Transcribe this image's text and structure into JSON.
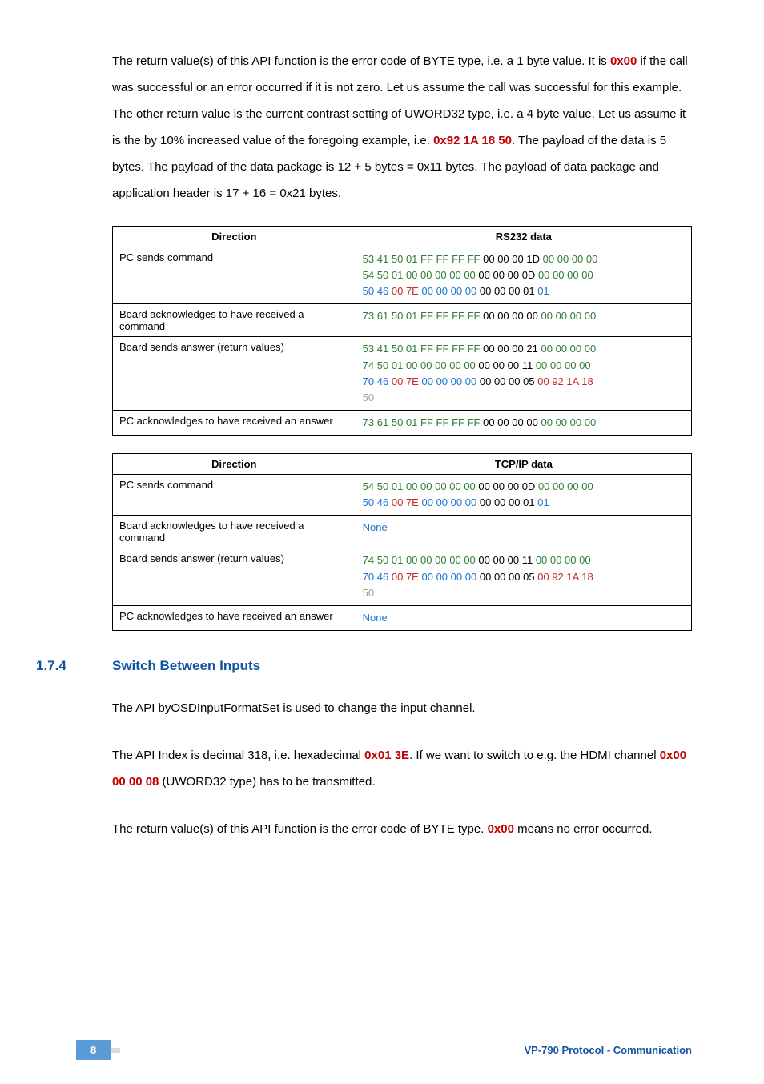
{
  "para1": {
    "t1": "The return value(s) of this API function is the error code of BYTE type, i.e. a 1 byte value. It is ",
    "h1": "0x00",
    "t2": " if the call was successful or an error occurred if it is not zero. Let us assume the call was successful for this example. The other return value is the current contrast setting of UWORD32 type, i.e. a 4 byte value. Let us assume it is the by 10% increased value of the foregoing example, i.e. ",
    "h2": "0x92 1A 18 50",
    "t3": ". The payload of the data is 5 bytes. The payload of the data package is 12 + 5 bytes = 0x11 bytes. The payload of data package and application header is 17 + 16 = 0x21 bytes."
  },
  "table1": {
    "h1": "Direction",
    "h2": "RS232 data",
    "rows": [
      {
        "dir": "PC sends command",
        "bytes": [
          [
            "g",
            "53"
          ],
          [
            "g",
            "41"
          ],
          [
            "g",
            "50"
          ],
          [
            "g",
            "01"
          ],
          [
            "g",
            "FF"
          ],
          [
            "g",
            "FF"
          ],
          [
            "g",
            "FF"
          ],
          [
            "g",
            "FF"
          ],
          [
            "k",
            "00"
          ],
          [
            "k",
            "00"
          ],
          [
            "k",
            "00"
          ],
          [
            "k",
            "1D"
          ],
          [
            "g",
            "00"
          ],
          [
            "g",
            "00"
          ],
          [
            "g",
            "00"
          ],
          [
            "g",
            "00"
          ],
          [
            "br"
          ],
          [
            "g",
            "54"
          ],
          [
            "g",
            "50"
          ],
          [
            "g",
            "01"
          ],
          [
            "g",
            "00"
          ],
          [
            "g",
            "00"
          ],
          [
            "g",
            "00"
          ],
          [
            "g",
            "00"
          ],
          [
            "g",
            "00"
          ],
          [
            "k",
            "00"
          ],
          [
            "k",
            "00"
          ],
          [
            "k",
            "00"
          ],
          [
            "k",
            "0D"
          ],
          [
            "g",
            "00"
          ],
          [
            "g",
            "00"
          ],
          [
            "g",
            "00"
          ],
          [
            "g",
            "00"
          ],
          [
            "br"
          ],
          [
            "b",
            "50"
          ],
          [
            "b",
            "46"
          ],
          [
            "r",
            "00"
          ],
          [
            "r",
            "7E"
          ],
          [
            "b",
            "00"
          ],
          [
            "b",
            "00"
          ],
          [
            "b",
            "00"
          ],
          [
            "b",
            "00"
          ],
          [
            "k",
            "00"
          ],
          [
            "k",
            "00"
          ],
          [
            "k",
            "00"
          ],
          [
            "k",
            "01"
          ],
          [
            "b",
            "01"
          ]
        ]
      },
      {
        "dir": "Board acknowledges to have received a command",
        "bytes": [
          [
            "g",
            "73"
          ],
          [
            "g",
            "61"
          ],
          [
            "g",
            "50"
          ],
          [
            "g",
            "01"
          ],
          [
            "g",
            "FF"
          ],
          [
            "g",
            "FF"
          ],
          [
            "g",
            "FF"
          ],
          [
            "g",
            "FF"
          ],
          [
            "k",
            "00"
          ],
          [
            "k",
            "00"
          ],
          [
            "k",
            "00"
          ],
          [
            "k",
            "00"
          ],
          [
            "g",
            "00"
          ],
          [
            "g",
            "00"
          ],
          [
            "g",
            "00"
          ],
          [
            "g",
            "00"
          ]
        ]
      },
      {
        "dir": "Board sends answer (return values)",
        "bytes": [
          [
            "g",
            "53"
          ],
          [
            "g",
            "41"
          ],
          [
            "g",
            "50"
          ],
          [
            "g",
            "01"
          ],
          [
            "g",
            "FF"
          ],
          [
            "g",
            "FF"
          ],
          [
            "g",
            "FF"
          ],
          [
            "g",
            "FF"
          ],
          [
            "k",
            "00"
          ],
          [
            "k",
            "00"
          ],
          [
            "k",
            "00"
          ],
          [
            "k",
            "21"
          ],
          [
            "g",
            "00"
          ],
          [
            "g",
            "00"
          ],
          [
            "g",
            "00"
          ],
          [
            "g",
            "00"
          ],
          [
            "br"
          ],
          [
            "g",
            "74"
          ],
          [
            "g",
            "50"
          ],
          [
            "g",
            "01"
          ],
          [
            "g",
            "00"
          ],
          [
            "g",
            "00"
          ],
          [
            "g",
            "00"
          ],
          [
            "g",
            "00"
          ],
          [
            "g",
            "00"
          ],
          [
            "k",
            "00"
          ],
          [
            "k",
            "00"
          ],
          [
            "k",
            "00"
          ],
          [
            "k",
            "11"
          ],
          [
            "g",
            "00"
          ],
          [
            "g",
            "00"
          ],
          [
            "g",
            "00"
          ],
          [
            "g",
            "00"
          ],
          [
            "br"
          ],
          [
            "b",
            "70"
          ],
          [
            "b",
            "46"
          ],
          [
            "r",
            "00"
          ],
          [
            "r",
            "7E"
          ],
          [
            "b",
            "00"
          ],
          [
            "b",
            "00"
          ],
          [
            "b",
            "00"
          ],
          [
            "b",
            "00"
          ],
          [
            "k",
            "00"
          ],
          [
            "k",
            "00"
          ],
          [
            "k",
            "00"
          ],
          [
            "k",
            "05"
          ],
          [
            "r",
            "00"
          ],
          [
            "r",
            "92"
          ],
          [
            "r",
            "1A"
          ],
          [
            "r",
            "18"
          ],
          [
            "br"
          ],
          [
            "x",
            "50"
          ]
        ]
      },
      {
        "dir": "PC acknowledges to have received an answer",
        "bytes": [
          [
            "g",
            "73"
          ],
          [
            "g",
            "61"
          ],
          [
            "g",
            "50"
          ],
          [
            "g",
            "01"
          ],
          [
            "g",
            "FF"
          ],
          [
            "g",
            "FF"
          ],
          [
            "g",
            "FF"
          ],
          [
            "g",
            "FF"
          ],
          [
            "k",
            "00"
          ],
          [
            "k",
            "00"
          ],
          [
            "k",
            "00"
          ],
          [
            "k",
            "00"
          ],
          [
            "g",
            "00"
          ],
          [
            "g",
            "00"
          ],
          [
            "g",
            "00"
          ],
          [
            "g",
            "00"
          ]
        ]
      }
    ]
  },
  "table2": {
    "h1": "Direction",
    "h2": "TCP/IP data",
    "rows": [
      {
        "dir": "PC sends command",
        "bytes": [
          [
            "g",
            "54"
          ],
          [
            "g",
            "50"
          ],
          [
            "g",
            "01"
          ],
          [
            "g",
            "00"
          ],
          [
            "g",
            "00"
          ],
          [
            "g",
            "00"
          ],
          [
            "g",
            "00"
          ],
          [
            "g",
            "00"
          ],
          [
            "k",
            "00"
          ],
          [
            "k",
            "00"
          ],
          [
            "k",
            "00"
          ],
          [
            "k",
            "0D"
          ],
          [
            "g",
            "00"
          ],
          [
            "g",
            "00"
          ],
          [
            "g",
            "00"
          ],
          [
            "g",
            "00"
          ],
          [
            "br"
          ],
          [
            "b",
            "50"
          ],
          [
            "b",
            "46"
          ],
          [
            "r",
            "00"
          ],
          [
            "r",
            "7E"
          ],
          [
            "b",
            "00"
          ],
          [
            "b",
            "00"
          ],
          [
            "b",
            "00"
          ],
          [
            "b",
            "00"
          ],
          [
            "k",
            "00"
          ],
          [
            "k",
            "00"
          ],
          [
            "k",
            "00"
          ],
          [
            "k",
            "01"
          ],
          [
            "b",
            "01"
          ]
        ]
      },
      {
        "dir": "Board acknowledges to have received a command",
        "none": "None"
      },
      {
        "dir": "Board sends answer (return values)",
        "bytes": [
          [
            "g",
            "74"
          ],
          [
            "g",
            "50"
          ],
          [
            "g",
            "01"
          ],
          [
            "g",
            "00"
          ],
          [
            "g",
            "00"
          ],
          [
            "g",
            "00"
          ],
          [
            "g",
            "00"
          ],
          [
            "g",
            "00"
          ],
          [
            "k",
            "00"
          ],
          [
            "k",
            "00"
          ],
          [
            "k",
            "00"
          ],
          [
            "k",
            "11"
          ],
          [
            "g",
            "00"
          ],
          [
            "g",
            "00"
          ],
          [
            "g",
            "00"
          ],
          [
            "g",
            "00"
          ],
          [
            "br"
          ],
          [
            "b",
            "70"
          ],
          [
            "b",
            "46"
          ],
          [
            "r",
            "00"
          ],
          [
            "r",
            "7E"
          ],
          [
            "b",
            "00"
          ],
          [
            "b",
            "00"
          ],
          [
            "b",
            "00"
          ],
          [
            "b",
            "00"
          ],
          [
            "k",
            "00"
          ],
          [
            "k",
            "00"
          ],
          [
            "k",
            "00"
          ],
          [
            "k",
            "05"
          ],
          [
            "r",
            "00"
          ],
          [
            "r",
            "92"
          ],
          [
            "r",
            "1A"
          ],
          [
            "r",
            "18"
          ],
          [
            "br"
          ],
          [
            "x",
            "50"
          ]
        ]
      },
      {
        "dir": "PC acknowledges to have received an answer",
        "none": "None"
      }
    ]
  },
  "section": {
    "num": "1.7.4",
    "title": "Switch Between Inputs"
  },
  "para2": "The API byOSDInputFormatSet is used to change the input channel.",
  "para3": {
    "t1": "The API Index is decimal 318, i.e. hexadecimal ",
    "h1": "0x01 3E",
    "t2": ". If we want to switch to e.g. the HDMI channel ",
    "h2": "0x00 00 00 08",
    "t3": " (UWORD32 type) has to be transmitted."
  },
  "para4": {
    "t1": "The return value(s) of this API function is the error code of BYTE type. ",
    "h1": "0x00",
    "t2": " means no error occurred."
  },
  "footer": {
    "page": "8",
    "title": "VP-790 Protocol - Communication"
  }
}
